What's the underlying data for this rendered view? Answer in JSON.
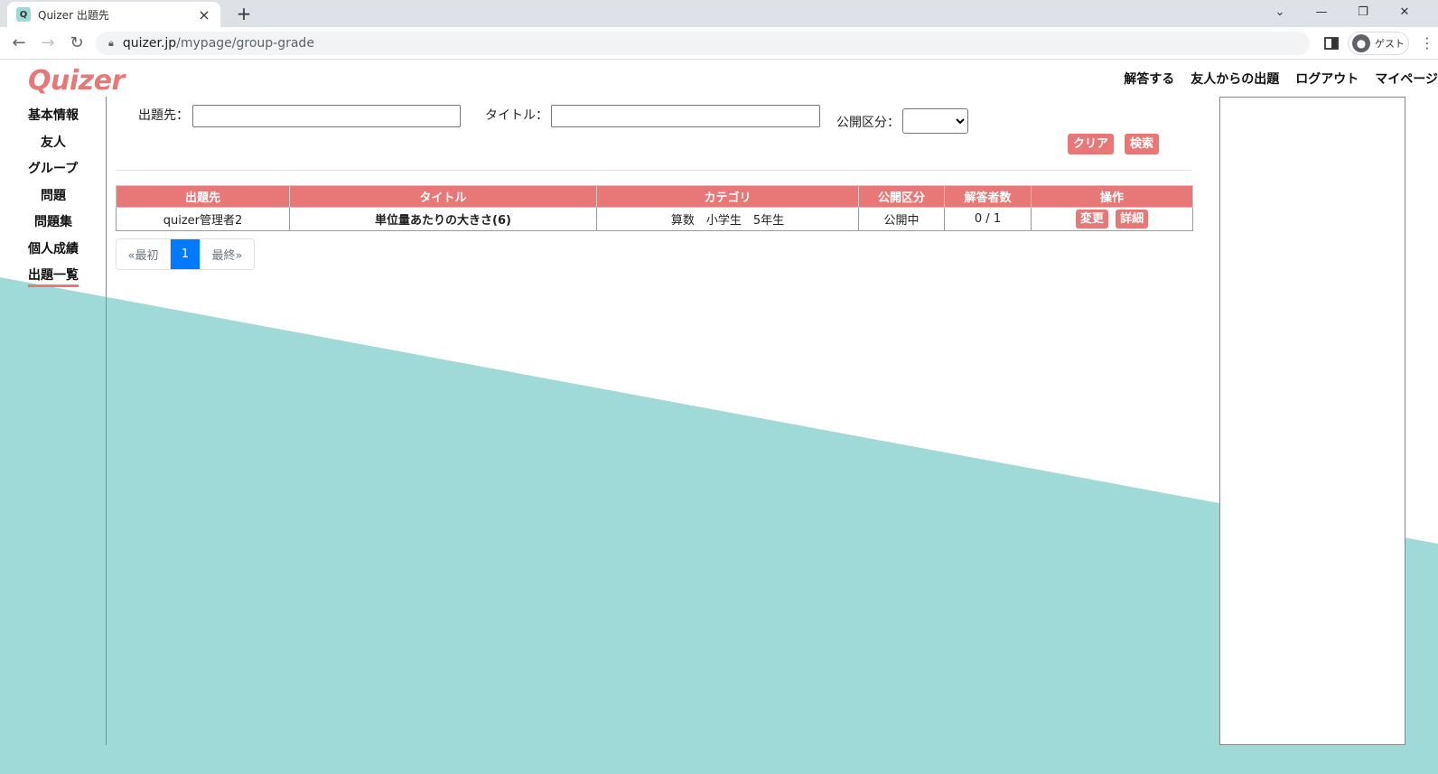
{
  "browser": {
    "tab_title": "Quizer 出題先",
    "url_host": "quizer.jp",
    "url_path": "/mypage/group-grade",
    "profile_label": "ゲスト"
  },
  "header": {
    "logo": "Quizer",
    "nav": [
      "解答する",
      "友人からの出題",
      "ログアウト",
      "マイページ"
    ]
  },
  "sidebar": {
    "items": [
      "基本情報",
      "友人",
      "グループ",
      "問題",
      "問題集",
      "個人成績",
      "出題一覧"
    ],
    "active_index": 6
  },
  "search": {
    "target_label": "出題先：",
    "title_label": "タイトル：",
    "visibility_label": "公開区分：",
    "target_value": "",
    "title_value": "",
    "visibility_value": "",
    "clear_label": "クリア",
    "search_label": "検索"
  },
  "table": {
    "headers": [
      "出題先",
      "タイトル",
      "カテゴリ",
      "公開区分",
      "解答者数",
      "操作"
    ],
    "rows": [
      {
        "target": "quizer管理者2",
        "title": "単位量あたりの大きさ(6)",
        "category": "算数　小学生　5年生",
        "visibility": "公開中",
        "respondents": "0 / 1",
        "edit_label": "変更",
        "detail_label": "詳細"
      }
    ]
  },
  "pagination": {
    "first_label": "«最初",
    "current": "1",
    "last_label": "最終»"
  },
  "colors": {
    "accent": "#e87878",
    "teal": "#9fdad9",
    "page_active": "#007bff"
  }
}
